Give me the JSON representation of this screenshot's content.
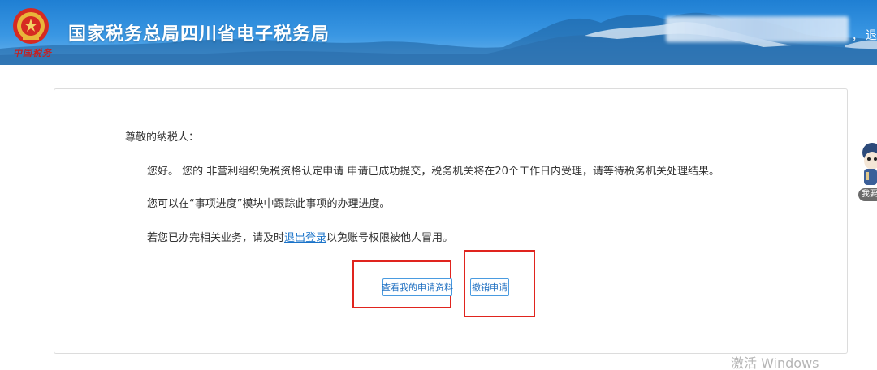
{
  "header": {
    "title": "国家税务总局四川省电子税务局",
    "brand_mark": "中国税务",
    "separator": "，",
    "logout_label": "退"
  },
  "notice": {
    "greeting": "尊敬的纳税人：",
    "line1": "您好。 您的 非营利组织免税资格认定申请 申请已成功提交，税务机关将在20个工作日内受理，请等待税务机关处理结果。",
    "line2": "您可以在“事项进度”模块中跟踪此事项的办理进度。",
    "line3_prefix": "若您已办完相关业务，请及时",
    "line3_link": "退出登录",
    "line3_suffix": "以免账号权限被他人冒用。"
  },
  "actions": {
    "view_label": "查看我的申请资料",
    "revoke_label": "撤销申请"
  },
  "mascot": {
    "label": "我要"
  },
  "watermark": {
    "text": "激活 Windows"
  },
  "colors": {
    "header_blue": "#1f7fd3",
    "link_blue": "#1a73c9",
    "highlight_red": "#e0241e"
  }
}
